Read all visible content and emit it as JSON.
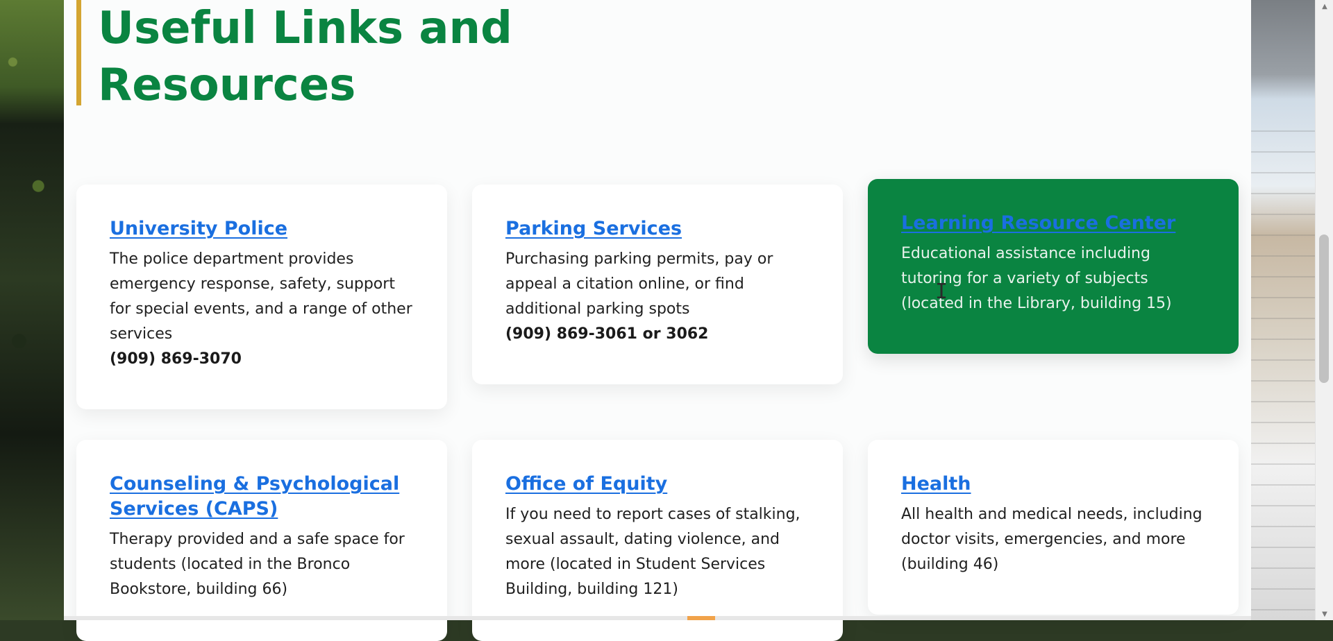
{
  "page": {
    "title": "Useful Links and\nResources",
    "colors": {
      "title_green": "#0a8441",
      "accent_gold": "#d4a531",
      "card_active_green": "#0a8441",
      "link_blue": "#1a6fe0"
    }
  },
  "cards": [
    {
      "title": "University Police",
      "description": "The police department provides emergency response, safety, support for special events, and a range of other services",
      "phone": "(909) 869-3070"
    },
    {
      "title": "Parking Services",
      "description": "Purchasing parking permits, pay or appeal a citation online, or find additional parking spots",
      "phone": "(909) 869-3061 or 3062"
    },
    {
      "title": "Learning Resource Center",
      "description": "Educational assistance including tutoring for a variety of subjects (located in the Library, building 15)",
      "phone": ""
    },
    {
      "title": "Counseling & Psychological Services (CAPS)",
      "description": "Therapy provided and a safe space for students (located in the Bronco Bookstore, building 66)",
      "phone": ""
    },
    {
      "title": "Office of Equity",
      "description": "If you need to report cases of stalking, sexual assault, dating violence, and more (located in Student Services Building, building 121)",
      "phone": ""
    },
    {
      "title": "Health",
      "description": "All health and medical needs, including doctor visits, emergencies, and more (building 46)",
      "phone": ""
    }
  ],
  "icons": {
    "scroll_up": "chevron-up-icon",
    "scroll_down": "chevron-down-icon",
    "cursor": "text-cursor-icon"
  }
}
